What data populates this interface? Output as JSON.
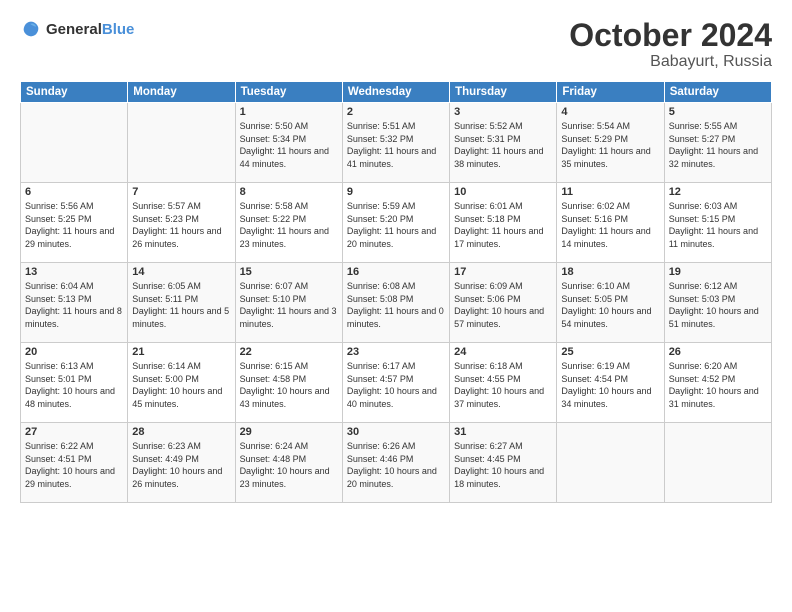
{
  "header": {
    "logo": {
      "text_general": "General",
      "text_blue": "Blue"
    },
    "month": "October 2024",
    "location": "Babayurt, Russia"
  },
  "weekdays": [
    "Sunday",
    "Monday",
    "Tuesday",
    "Wednesday",
    "Thursday",
    "Friday",
    "Saturday"
  ],
  "weeks": [
    [
      {
        "day": "",
        "info": ""
      },
      {
        "day": "",
        "info": ""
      },
      {
        "day": "1",
        "info": "Sunrise: 5:50 AM\nSunset: 5:34 PM\nDaylight: 11 hours and 44 minutes."
      },
      {
        "day": "2",
        "info": "Sunrise: 5:51 AM\nSunset: 5:32 PM\nDaylight: 11 hours and 41 minutes."
      },
      {
        "day": "3",
        "info": "Sunrise: 5:52 AM\nSunset: 5:31 PM\nDaylight: 11 hours and 38 minutes."
      },
      {
        "day": "4",
        "info": "Sunrise: 5:54 AM\nSunset: 5:29 PM\nDaylight: 11 hours and 35 minutes."
      },
      {
        "day": "5",
        "info": "Sunrise: 5:55 AM\nSunset: 5:27 PM\nDaylight: 11 hours and 32 minutes."
      }
    ],
    [
      {
        "day": "6",
        "info": "Sunrise: 5:56 AM\nSunset: 5:25 PM\nDaylight: 11 hours and 29 minutes."
      },
      {
        "day": "7",
        "info": "Sunrise: 5:57 AM\nSunset: 5:23 PM\nDaylight: 11 hours and 26 minutes."
      },
      {
        "day": "8",
        "info": "Sunrise: 5:58 AM\nSunset: 5:22 PM\nDaylight: 11 hours and 23 minutes."
      },
      {
        "day": "9",
        "info": "Sunrise: 5:59 AM\nSunset: 5:20 PM\nDaylight: 11 hours and 20 minutes."
      },
      {
        "day": "10",
        "info": "Sunrise: 6:01 AM\nSunset: 5:18 PM\nDaylight: 11 hours and 17 minutes."
      },
      {
        "day": "11",
        "info": "Sunrise: 6:02 AM\nSunset: 5:16 PM\nDaylight: 11 hours and 14 minutes."
      },
      {
        "day": "12",
        "info": "Sunrise: 6:03 AM\nSunset: 5:15 PM\nDaylight: 11 hours and 11 minutes."
      }
    ],
    [
      {
        "day": "13",
        "info": "Sunrise: 6:04 AM\nSunset: 5:13 PM\nDaylight: 11 hours and 8 minutes."
      },
      {
        "day": "14",
        "info": "Sunrise: 6:05 AM\nSunset: 5:11 PM\nDaylight: 11 hours and 5 minutes."
      },
      {
        "day": "15",
        "info": "Sunrise: 6:07 AM\nSunset: 5:10 PM\nDaylight: 11 hours and 3 minutes."
      },
      {
        "day": "16",
        "info": "Sunrise: 6:08 AM\nSunset: 5:08 PM\nDaylight: 11 hours and 0 minutes."
      },
      {
        "day": "17",
        "info": "Sunrise: 6:09 AM\nSunset: 5:06 PM\nDaylight: 10 hours and 57 minutes."
      },
      {
        "day": "18",
        "info": "Sunrise: 6:10 AM\nSunset: 5:05 PM\nDaylight: 10 hours and 54 minutes."
      },
      {
        "day": "19",
        "info": "Sunrise: 6:12 AM\nSunset: 5:03 PM\nDaylight: 10 hours and 51 minutes."
      }
    ],
    [
      {
        "day": "20",
        "info": "Sunrise: 6:13 AM\nSunset: 5:01 PM\nDaylight: 10 hours and 48 minutes."
      },
      {
        "day": "21",
        "info": "Sunrise: 6:14 AM\nSunset: 5:00 PM\nDaylight: 10 hours and 45 minutes."
      },
      {
        "day": "22",
        "info": "Sunrise: 6:15 AM\nSunset: 4:58 PM\nDaylight: 10 hours and 43 minutes."
      },
      {
        "day": "23",
        "info": "Sunrise: 6:17 AM\nSunset: 4:57 PM\nDaylight: 10 hours and 40 minutes."
      },
      {
        "day": "24",
        "info": "Sunrise: 6:18 AM\nSunset: 4:55 PM\nDaylight: 10 hours and 37 minutes."
      },
      {
        "day": "25",
        "info": "Sunrise: 6:19 AM\nSunset: 4:54 PM\nDaylight: 10 hours and 34 minutes."
      },
      {
        "day": "26",
        "info": "Sunrise: 6:20 AM\nSunset: 4:52 PM\nDaylight: 10 hours and 31 minutes."
      }
    ],
    [
      {
        "day": "27",
        "info": "Sunrise: 6:22 AM\nSunset: 4:51 PM\nDaylight: 10 hours and 29 minutes."
      },
      {
        "day": "28",
        "info": "Sunrise: 6:23 AM\nSunset: 4:49 PM\nDaylight: 10 hours and 26 minutes."
      },
      {
        "day": "29",
        "info": "Sunrise: 6:24 AM\nSunset: 4:48 PM\nDaylight: 10 hours and 23 minutes."
      },
      {
        "day": "30",
        "info": "Sunrise: 6:26 AM\nSunset: 4:46 PM\nDaylight: 10 hours and 20 minutes."
      },
      {
        "day": "31",
        "info": "Sunrise: 6:27 AM\nSunset: 4:45 PM\nDaylight: 10 hours and 18 minutes."
      },
      {
        "day": "",
        "info": ""
      },
      {
        "day": "",
        "info": ""
      }
    ]
  ]
}
